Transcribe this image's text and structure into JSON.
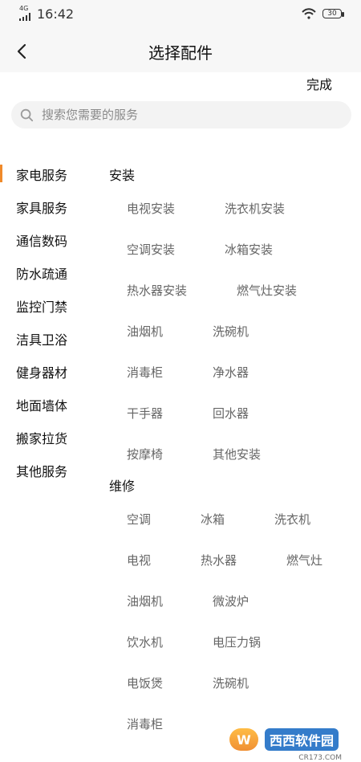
{
  "status_bar": {
    "network": "4G",
    "time": "16:42",
    "battery": "30"
  },
  "header": {
    "title": "选择配件",
    "done_label": "完成"
  },
  "search": {
    "placeholder": "搜索您需要的服务"
  },
  "sidebar": {
    "items": [
      {
        "label": "家电服务"
      },
      {
        "label": "家具服务"
      },
      {
        "label": "通信数码"
      },
      {
        "label": "防水疏通"
      },
      {
        "label": "监控门禁"
      },
      {
        "label": "洁具卫浴"
      },
      {
        "label": "健身器材"
      },
      {
        "label": "地面墙体"
      },
      {
        "label": "搬家拉货"
      },
      {
        "label": "其他服务"
      }
    ],
    "active_index": 0,
    "accent_color": "#f08a2a"
  },
  "content": {
    "install": {
      "title": "安装",
      "rows": [
        [
          "电视安装",
          "洗衣机安装"
        ],
        [
          "空调安装",
          "冰箱安装"
        ],
        [
          "热水器安装",
          "燃气灶安装"
        ],
        [
          "油烟机",
          "洗碗机"
        ],
        [
          "消毒柜",
          "净水器"
        ],
        [
          "干手器",
          "回水器"
        ],
        [
          "按摩椅",
          "其他安装"
        ]
      ]
    },
    "repair": {
      "title": "维修",
      "rows": [
        [
          "空调",
          "冰箱",
          "洗衣机"
        ],
        [
          "电视",
          "热水器",
          "燃气灶"
        ],
        [
          "油烟机",
          "微波炉"
        ],
        [
          "饮水机",
          "电压力锅"
        ],
        [
          "电饭煲",
          "洗碗机"
        ],
        [
          "消毒柜"
        ]
      ]
    }
  },
  "watermark": {
    "badge": "W",
    "text": "西西软件园",
    "sub": "CR173.COM"
  }
}
